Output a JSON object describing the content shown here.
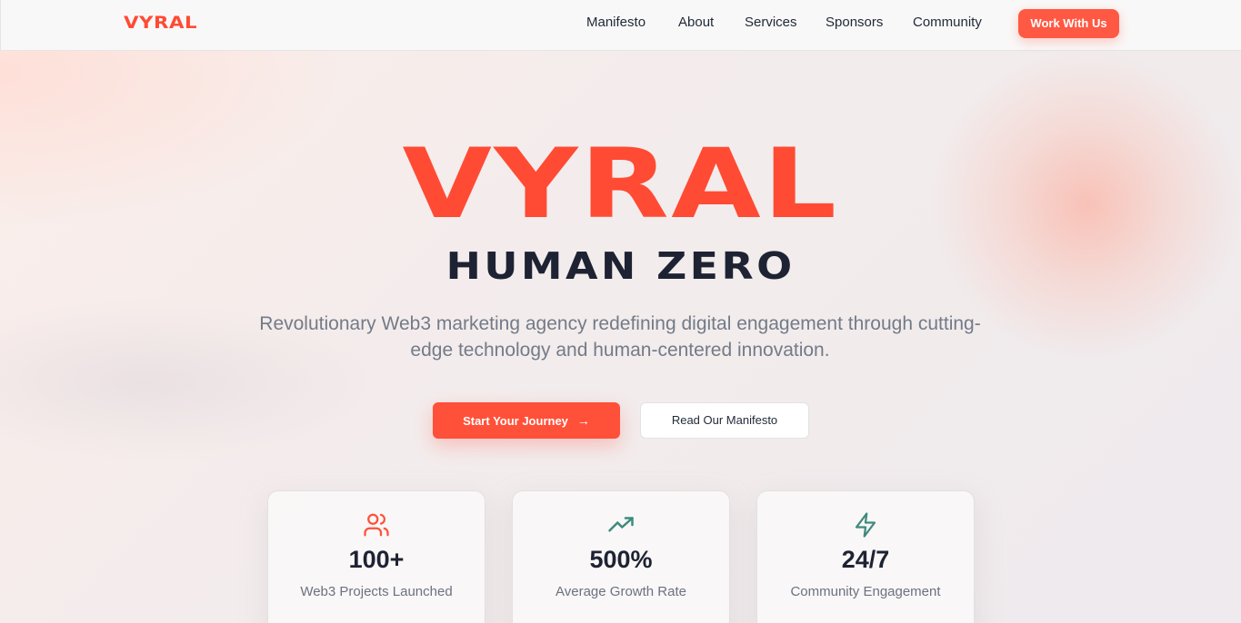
{
  "header": {
    "logo": "VYRAL",
    "nav": [
      {
        "label": "Manifesto"
      },
      {
        "label": "About"
      },
      {
        "label": "Services"
      },
      {
        "label": "Sponsors"
      },
      {
        "label": "Community"
      }
    ],
    "cta": "Work With Us"
  },
  "hero": {
    "title": "VYRAL",
    "subtitle": "HUMAN ZERO",
    "tagline": "Revolutionary Web3 marketing agency redefining digital engagement through cutting-edge technology and human-centered innovation.",
    "primary_button": "Start Your Journey",
    "secondary_button": "Read Our Manifesto"
  },
  "stats": [
    {
      "icon": "users-icon",
      "value": "100+",
      "label": "Web3 Projects Launched",
      "color": "#ff5039"
    },
    {
      "icon": "trending-up-icon",
      "value": "500%",
      "label": "Average Growth Rate",
      "color": "#3f8a7e"
    },
    {
      "icon": "lightning-icon",
      "value": "24/7",
      "label": "Community Engagement",
      "color": "#3f8a7e"
    }
  ],
  "colors": {
    "accent": "#ff4b34",
    "dark": "#1e2333",
    "teal": "#3f8a7e"
  }
}
